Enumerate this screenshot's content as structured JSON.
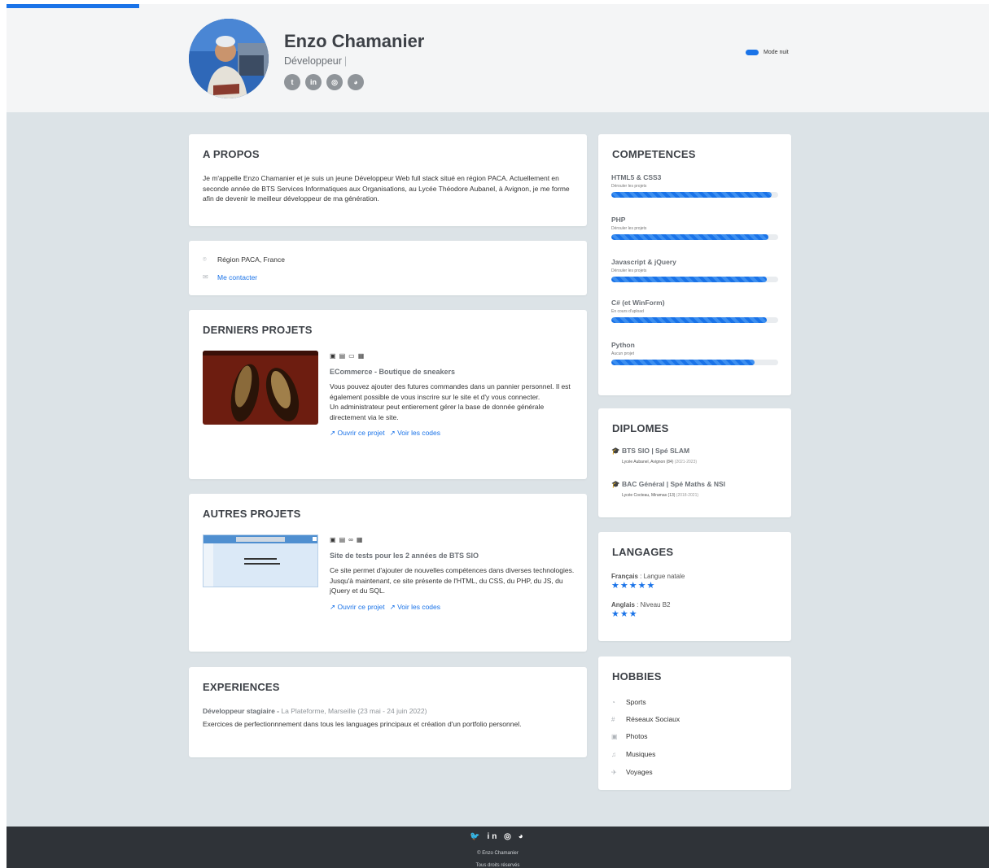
{
  "header": {
    "name": "Enzo Chamanier",
    "role": "Développeur",
    "role_caret": "|",
    "socials": [
      {
        "icon": "twitter-icon",
        "glyph": "t"
      },
      {
        "icon": "linkedin-icon",
        "glyph": "in"
      },
      {
        "icon": "instagram-icon",
        "glyph": "◎"
      },
      {
        "icon": "github-icon",
        "glyph": "◕"
      }
    ],
    "night_mode_label": "Mode nuit"
  },
  "about": {
    "title": "A PROPOS",
    "text": "Je m'appelle Enzo Chamanier et je suis un jeune Développeur Web full stack situé en région PACA. Actuellement en seconde année de BTS Services Informatiques aux Organisations, au Lycée Théodore Aubanel, à Avignon, je me forme afin de devenir le meilleur développeur de ma génération."
  },
  "contact": {
    "location": "Région PACA, France",
    "contact_link": "Me contacter"
  },
  "latest_projects": {
    "title": "DERNIERS PROJETS",
    "project_title": "ECommerce - Boutique de sneakers",
    "lines": [
      "Vous pouvez ajouter des futures commandes dans un pannier personnel. Il est également possible de vous inscrire sur le site et d'y vous connecter.",
      "Un administrateur peut entierement gérer la base de donnée générale directement via le site."
    ],
    "open_label": "Ouvrir ce projet",
    "code_label": "Voir les codes"
  },
  "other_projects": {
    "title": "AUTRES PROJETS",
    "project_title": "Site de tests pour les 2 années de BTS SIO",
    "text": "Ce site permet d'ajouter de nouvelles compétences dans diverses technologies. Jusqu'à maintenant, ce site présente de l'HTML, du CSS, du PHP, du JS, du jQuery et du SQL.",
    "open_label": "Ouvrir ce projet",
    "code_label": "Voir les codes"
  },
  "experiences": {
    "title": "EXPERIENCES",
    "job": "Développeur stagiaire -",
    "place": "La Plateforme, Marseille (23 mai - 24 juin 2022)",
    "text": "Exercices de perfectionnnement dans tous les languages principaux et création d'un portfolio personnel."
  },
  "skills": {
    "title": "COMPETENCES",
    "items": [
      {
        "name": "HTML5 & CSS3",
        "sub": "Dérouler les projets",
        "level": 0.96
      },
      {
        "name": "PHP",
        "sub": "Dérouler les projets",
        "level": 0.94
      },
      {
        "name": "Javascript & jQuery",
        "sub": "Dérouler les projets",
        "level": 0.93
      },
      {
        "name": "C# (et WinForm)",
        "sub": "En cours d'upload",
        "level": 0.93
      },
      {
        "name": "Python",
        "sub": "Aucun projet",
        "level": 0.86
      }
    ]
  },
  "diplomas": {
    "title": "DIPLOMES",
    "items": [
      {
        "name": "BTS SIO | Spé SLAM",
        "school": "Lycée Aubanel, Avignon (84)",
        "years": "(2021-2023)"
      },
      {
        "name": "BAC Général | Spé Maths & NSI",
        "school": "Lycée Cocteau, Miramas (13)",
        "years": "(2018-2021)"
      }
    ]
  },
  "languages": {
    "title": "LANGAGES",
    "items": [
      {
        "lang": "Français",
        "level": "Langue natale",
        "stars": "★★★★★"
      },
      {
        "lang": "Anglais",
        "level": "Niveau B2",
        "stars": "★★★"
      }
    ]
  },
  "hobbies": {
    "title": "HOBBIES",
    "items": [
      {
        "label": "Sports",
        "icon": "ball-icon",
        "glyph": "◔"
      },
      {
        "label": "Réseaux Sociaux",
        "icon": "hashtag-icon",
        "glyph": "#"
      },
      {
        "label": "Photos",
        "icon": "camera-icon",
        "glyph": "▣"
      },
      {
        "label": "Musiques",
        "icon": "music-icon",
        "glyph": "♫"
      },
      {
        "label": "Voyages",
        "icon": "plane-icon",
        "glyph": "✈"
      }
    ]
  },
  "footer": {
    "icons": "🐦 in ◎ ◕",
    "copyright": "© Enzo Chamanier",
    "rights": "Tous droits réservés"
  },
  "colors": {
    "accent": "#1a73e8",
    "background": "#dce3e7",
    "footer": "#2f3338"
  }
}
